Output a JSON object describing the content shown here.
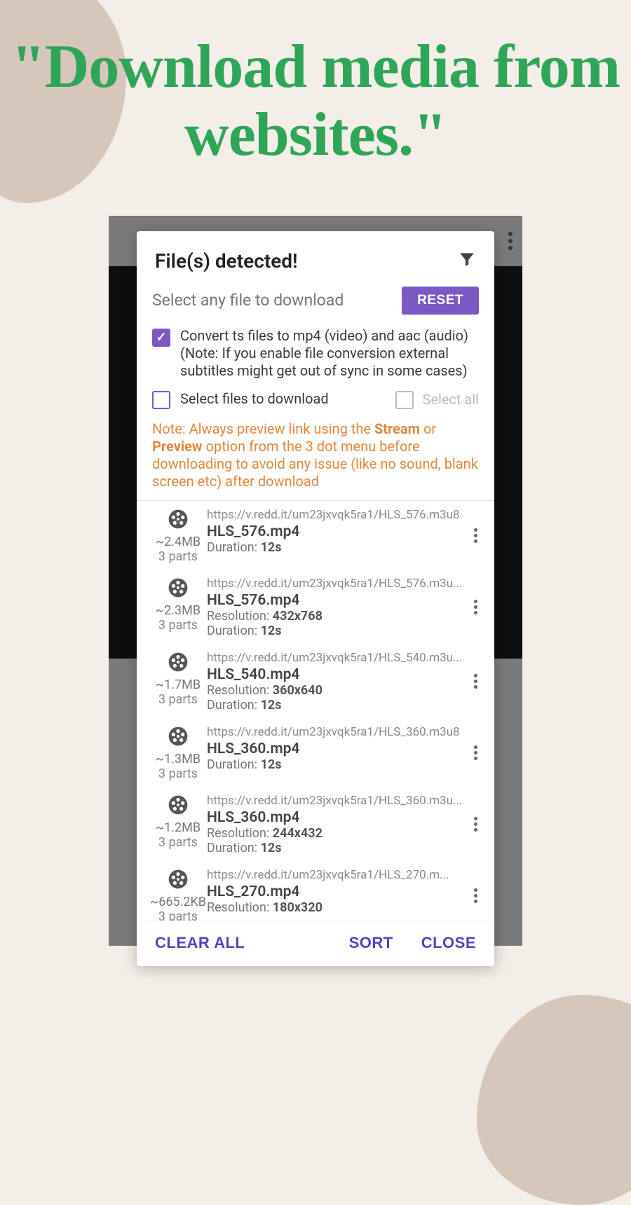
{
  "headline": "\"Download media from websites.\"",
  "modal": {
    "title": "File(s) detected!",
    "subtitle": "Select any file to download",
    "reset": "RESET",
    "convert_label": "Convert ts files to mp4 (video) and aac (audio) (Note: If you enable file conversion external subtitles might get out of sync in some cases)",
    "select_files_label": "Select files to download",
    "select_all": "Select all",
    "note_prefix": "Note: Always preview link using the ",
    "note_stream": "Stream",
    "note_or": " or ",
    "note_preview": "Preview",
    "note_suffix": " option from the 3 dot menu before downloading to avoid any issue (like no sound, blank screen etc) after download"
  },
  "footer": {
    "clear": "CLEAR ALL",
    "sort": "SORT",
    "close": "CLOSE"
  },
  "files": [
    {
      "size": "~2.4MB",
      "parts": "3 parts",
      "url": "https://v.redd.it/um23jxvqk5ra1/HLS_576.m3u8",
      "name": "HLS_576.mp4",
      "resolution": "",
      "duration": "12s"
    },
    {
      "size": "~2.3MB",
      "parts": "3 parts",
      "url": "https://v.redd.it/um23jxvqk5ra1/HLS_576.m3u...",
      "name": "HLS_576.mp4",
      "resolution": "432x768",
      "duration": "12s"
    },
    {
      "size": "~1.7MB",
      "parts": "3 parts",
      "url": "https://v.redd.it/um23jxvqk5ra1/HLS_540.m3u...",
      "name": "HLS_540.mp4",
      "resolution": "360x640",
      "duration": "12s"
    },
    {
      "size": "~1.3MB",
      "parts": "3 parts",
      "url": "https://v.redd.it/um23jxvqk5ra1/HLS_360.m3u8",
      "name": "HLS_360.mp4",
      "resolution": "",
      "duration": "12s"
    },
    {
      "size": "~1.2MB",
      "parts": "3 parts",
      "url": "https://v.redd.it/um23jxvqk5ra1/HLS_360.m3u...",
      "name": "HLS_360.mp4",
      "resolution": "244x432",
      "duration": "12s"
    },
    {
      "size": "~665.2KB",
      "parts": "3 parts",
      "url": "https://v.redd.it/um23jxvqk5ra1/HLS_270.m...",
      "name": "HLS_270.mp4",
      "resolution": "180x320",
      "duration": ""
    }
  ]
}
